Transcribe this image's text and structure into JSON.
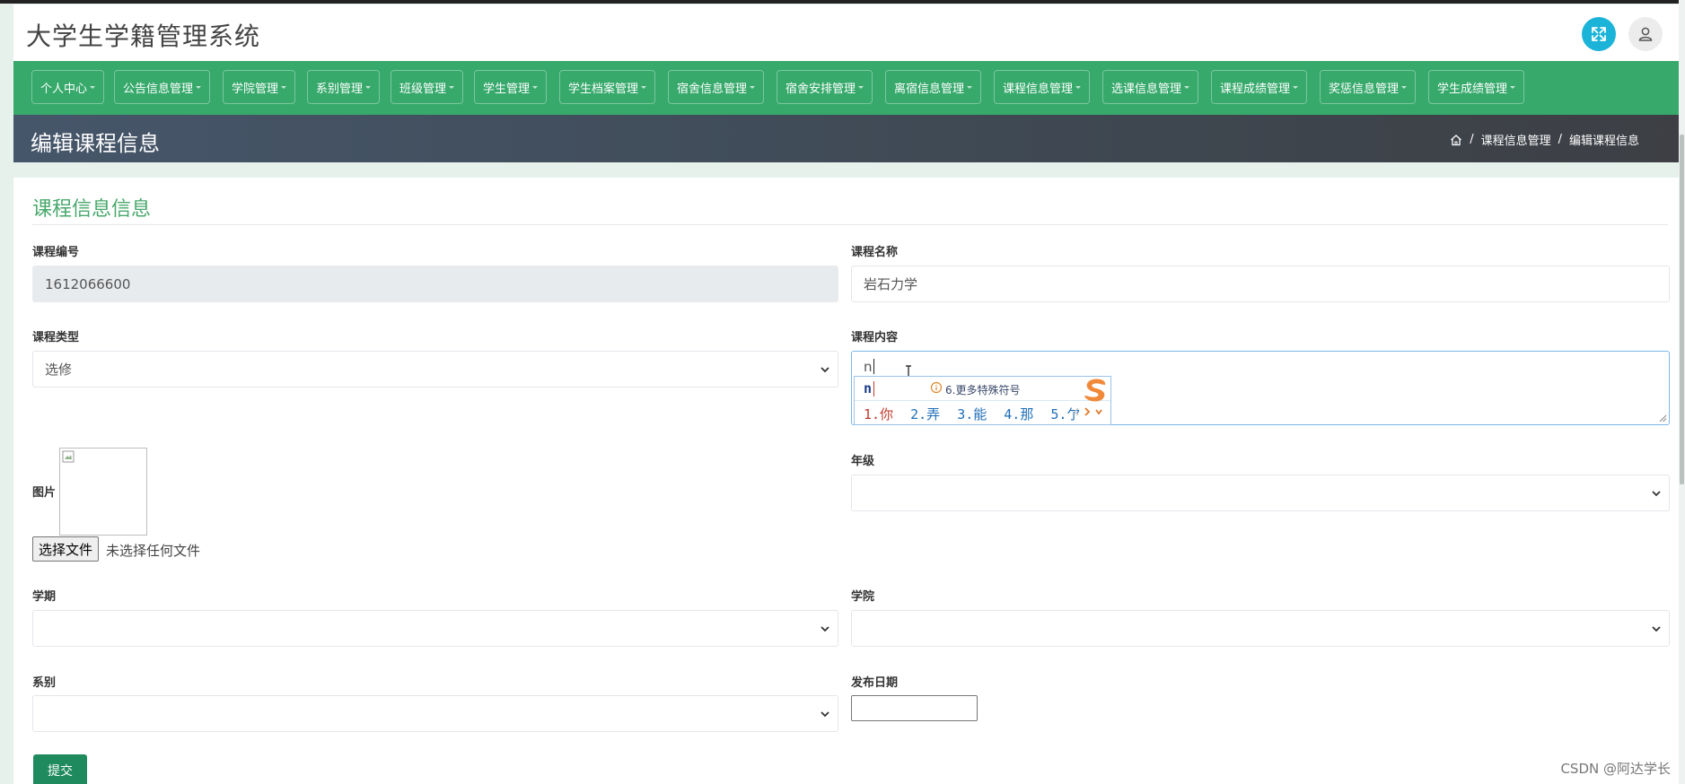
{
  "app": {
    "title": "大学生学籍管理系统"
  },
  "header": {
    "expand_icon": "expand-arrows-icon",
    "user_icon": "user-icon",
    "expand_color": "#1bb4d8"
  },
  "nav": {
    "color": "#36a96b",
    "items": [
      {
        "label": "个人中心"
      },
      {
        "label": "公告信息管理"
      },
      {
        "label": "学院管理"
      },
      {
        "label": "系别管理"
      },
      {
        "label": "班级管理"
      },
      {
        "label": "学生管理"
      },
      {
        "label": "学生档案管理"
      },
      {
        "label": "宿舍信息管理"
      },
      {
        "label": "宿舍安排管理"
      },
      {
        "label": "离宿信息管理"
      },
      {
        "label": "课程信息管理"
      },
      {
        "label": "选课信息管理"
      },
      {
        "label": "课程成绩管理"
      },
      {
        "label": "奖惩信息管理"
      },
      {
        "label": "学生成绩管理"
      }
    ]
  },
  "page": {
    "title": "编辑课程信息",
    "breadcrumb": {
      "home_icon": "home-icon",
      "separator": "/",
      "items": [
        "课程信息管理",
        "编辑课程信息"
      ]
    }
  },
  "form": {
    "section_title": "课程信息信息",
    "course_no": {
      "label": "课程编号",
      "value": "1612066600"
    },
    "course_name": {
      "label": "课程名称",
      "value": "岩石力学"
    },
    "course_type": {
      "label": "课程类型",
      "value": "选修"
    },
    "course_content": {
      "label": "课程内容",
      "value": "n"
    },
    "image": {
      "label": "图片",
      "file_button": "选择文件",
      "file_status": "未选择任何文件"
    },
    "grade": {
      "label": "年级",
      "value": ""
    },
    "semester": {
      "label": "学期",
      "value": ""
    },
    "college": {
      "label": "学院",
      "value": ""
    },
    "department": {
      "label": "系别",
      "value": ""
    },
    "publish_date": {
      "label": "发布日期",
      "value": ""
    },
    "submit": "提交"
  },
  "ime": {
    "pinyin": "n",
    "hint": "6.更多特殊符号",
    "candidates": [
      "1.你",
      "2.弄",
      "3.能",
      "4.那",
      "5.亇"
    ]
  },
  "watermark": "CSDN @阿达学长"
}
